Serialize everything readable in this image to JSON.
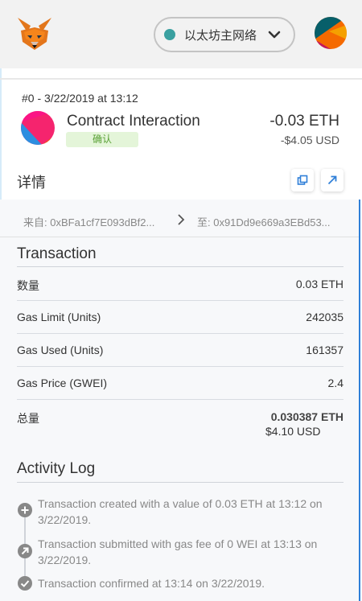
{
  "header": {
    "network_label": "以太坊主网络",
    "network_color": "#3aa0a0"
  },
  "transaction": {
    "nonce_date": "#0 - 3/22/2019 at 13:12",
    "title": "Contract Interaction",
    "status": "确认",
    "amount": "-0.03 ETH",
    "fiat": "-$4.05 USD"
  },
  "details": {
    "title": "详情",
    "copy_icon": "copy-icon",
    "open_icon": "open-external-icon",
    "from": "来自: 0xBFa1cf7E093dBf2...",
    "to": "至: 0x91Dd9e669a3EBd53..."
  },
  "transaction_section": {
    "title": "Transaction",
    "rows": [
      {
        "label": "数量",
        "value": "0.03 ETH"
      },
      {
        "label": "Gas Limit (Units)",
        "value": "242035"
      },
      {
        "label": "Gas Used (Units)",
        "value": "161357"
      },
      {
        "label": "Gas Price (GWEI)",
        "value": "2.4"
      }
    ],
    "total": {
      "label": "总量",
      "value": "0.030387 ETH",
      "subvalue": "$4.10 USD"
    }
  },
  "activity_log": {
    "title": "Activity Log",
    "items": [
      {
        "icon": "plus-icon",
        "text": "Transaction created with a value of 0.03 ETH at 13:12 on 3/22/2019."
      },
      {
        "icon": "arrow-up-right-icon",
        "text": "Transaction submitted with gas fee of 0 WEI at 13:13 on 3/22/2019."
      },
      {
        "icon": "check-icon",
        "text": "Transaction confirmed at 13:14 on 3/22/2019."
      }
    ]
  }
}
